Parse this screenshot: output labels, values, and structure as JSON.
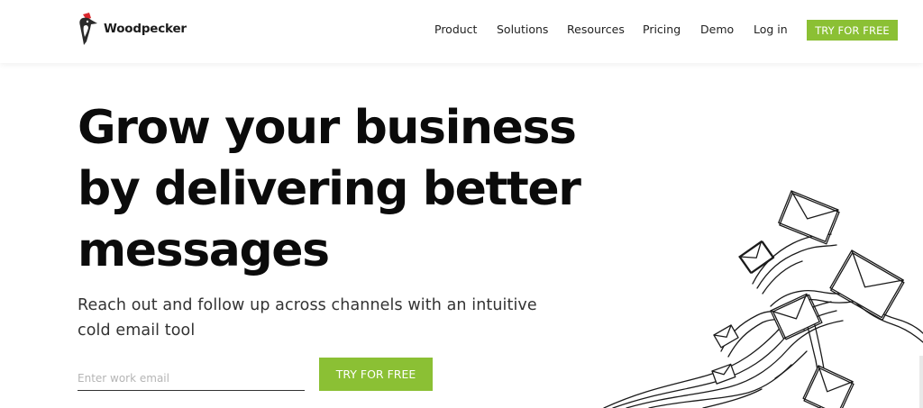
{
  "header": {
    "logo_text": "Woodpecker",
    "nav": [
      "Product",
      "Solutions",
      "Resources",
      "Pricing",
      "Demo",
      "Log in"
    ],
    "cta_label": "TRY FOR FREE"
  },
  "hero": {
    "title_lines": [
      "Grow your business",
      "by delivering better",
      "messages"
    ],
    "subtitle_lines": [
      "Reach out and follow up across channels with an intuitive",
      "cold email tool"
    ],
    "email_placeholder": "Enter work email",
    "cta_label": "TRY FOR FREE"
  },
  "colors": {
    "accent_green": "#8bc034",
    "logo_red": "#d9262c",
    "text_dark": "#0b0b0b"
  },
  "icons": {
    "logo": "woodpecker-bird-icon",
    "illustration": "flying-envelopes-illustration"
  }
}
